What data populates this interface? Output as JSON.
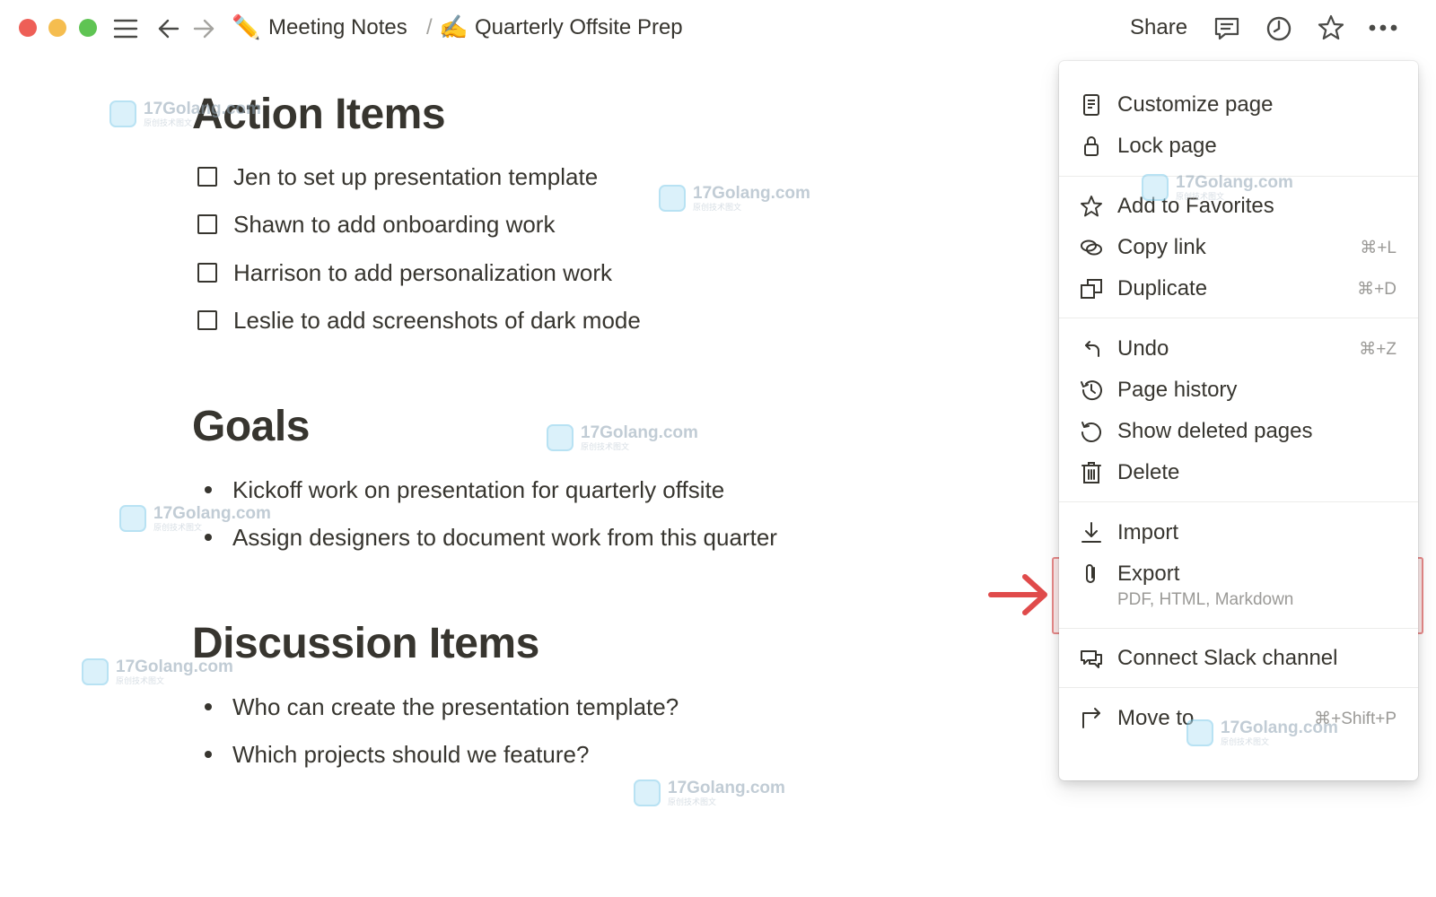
{
  "window": {
    "breadcrumb": {
      "parent": {
        "emoji": "✏️",
        "label": "Meeting Notes"
      },
      "separator": "/",
      "current": {
        "emoji": "✍️",
        "label": "Quarterly Offsite Prep"
      }
    },
    "actions": {
      "share_label": "Share"
    }
  },
  "document": {
    "action_items": {
      "heading": "Action Items",
      "todos": [
        "Jen to set up presentation template",
        "Shawn to add onboarding work",
        "Harrison to add personalization work",
        "Leslie to add screenshots of dark mode"
      ]
    },
    "goals": {
      "heading": "Goals",
      "bullets": [
        "Kickoff work on presentation for quarterly offsite",
        "Assign designers to document work from this quarter"
      ]
    },
    "discussion_items": {
      "heading": "Discussion Items",
      "bullets": [
        "Who can create the presentation template?",
        "Which projects should we feature?"
      ]
    }
  },
  "menu": {
    "items": [
      {
        "label": "Customize page",
        "icon": "customize-page-icon"
      },
      {
        "label": "Lock page",
        "icon": "lock-icon"
      },
      {
        "label": "Add to Favorites",
        "icon": "star-icon"
      },
      {
        "label": "Copy link",
        "shortcut": "⌘+L",
        "icon": "link-icon"
      },
      {
        "label": "Duplicate",
        "shortcut": "⌘+D",
        "icon": "duplicate-icon"
      },
      {
        "label": "Undo",
        "shortcut": "⌘+Z",
        "icon": "undo-icon"
      },
      {
        "label": "Page history",
        "icon": "history-icon"
      },
      {
        "label": "Show deleted pages",
        "icon": "restore-icon"
      },
      {
        "label": "Delete",
        "icon": "trash-icon"
      },
      {
        "label": "Import",
        "icon": "import-icon"
      },
      {
        "label": "Export",
        "description": "PDF, HTML, Markdown",
        "icon": "paperclip-icon",
        "highlighted": true
      },
      {
        "label": "Connect Slack channel",
        "icon": "chat-icon"
      },
      {
        "label": "Move to",
        "shortcut": "⌘+Shift+P",
        "icon": "move-icon"
      }
    ]
  },
  "watermark": {
    "text": "17Golang.com",
    "subtext": "原创技术图文"
  },
  "colors": {
    "text": "#37352f",
    "muted": "#9b9a97",
    "highlight_border": "#e88a8a",
    "highlight_fill": "rgba(235,87,87,0.12)",
    "arrow": "#e04b4b"
  }
}
